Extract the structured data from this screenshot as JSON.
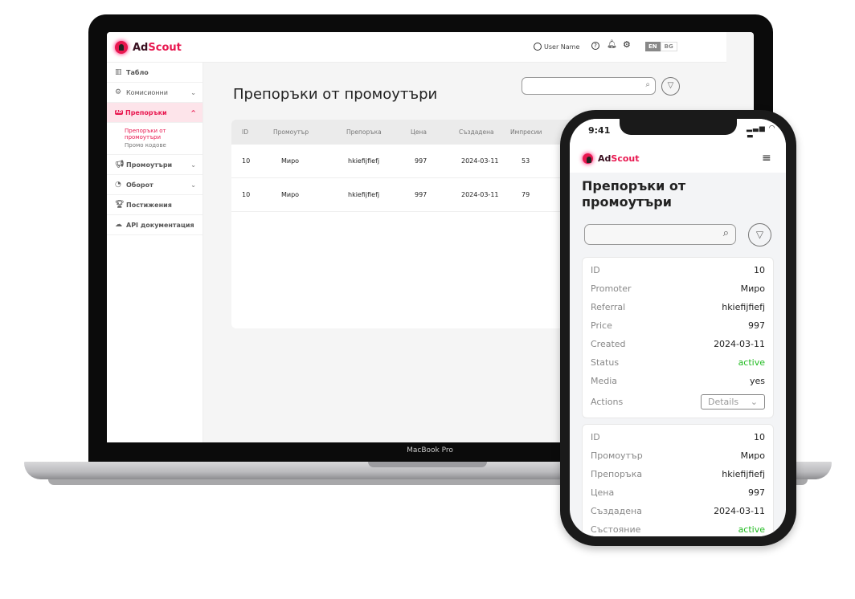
{
  "laptop": {
    "device_label": "MacBook Pro",
    "brand": {
      "ad": "Ad",
      "scout": "Scout"
    },
    "header": {
      "user": "User Name",
      "icons": [
        "user-icon",
        "help-icon",
        "bell-icon",
        "gear-icon"
      ],
      "lang": [
        "EN",
        "BG"
      ],
      "lang_active": "EN"
    },
    "sidebar": {
      "items": [
        {
          "label": "Табло",
          "icon": "dashboard-icon"
        },
        {
          "label": "Комисионни",
          "icon": "gear-icon",
          "chevron": "down"
        },
        {
          "label": "Препоръки",
          "icon": "ad-icon",
          "chevron": "up",
          "active": true
        },
        {
          "label": "Промоутъри",
          "icon": "megaphone-icon",
          "chevron": "down"
        },
        {
          "label": "Оборот",
          "icon": "chart-icon",
          "chevron": "down"
        },
        {
          "label": "Постижения",
          "icon": "trophy-icon"
        },
        {
          "label": "API документация",
          "icon": "cloud-icon"
        }
      ],
      "subitems": [
        {
          "label": "Препоръки от промоутъри",
          "active": true
        },
        {
          "label": "Промо кодове"
        }
      ]
    },
    "main": {
      "title": "Препоръки от промоутъри",
      "search_placeholder": "",
      "table": {
        "columns": [
          "ID",
          "Промоутър",
          "Препоръка",
          "Цена",
          "Създадена",
          "Импресии"
        ],
        "rows": [
          [
            "10",
            "Миро",
            "hkiefijfiefj",
            "997",
            "2024-03-11",
            "53"
          ],
          [
            "10",
            "Миро",
            "hkiefijfiefj",
            "997",
            "2024-03-11",
            "79"
          ]
        ]
      }
    }
  },
  "phone": {
    "time": "9:41",
    "title": "Препоръки от промоутъри",
    "search_placeholder": "",
    "cards": [
      {
        "rows": [
          [
            "ID",
            "10"
          ],
          [
            "Promoter",
            "Миро"
          ],
          [
            "Referral",
            "hkiefijfiefj"
          ],
          [
            "Price",
            "997"
          ],
          [
            "Created",
            "2024-03-11"
          ],
          [
            "Status",
            "active"
          ],
          [
            "Media",
            "yes"
          ]
        ],
        "actions_label": "Actions",
        "actions_value": "Details"
      },
      {
        "rows": [
          [
            "ID",
            "10"
          ],
          [
            "Промоутър",
            "Миро"
          ],
          [
            "Препоръка",
            "hkiefijfiefj"
          ],
          [
            "Цена",
            "997"
          ],
          [
            "Създадена",
            "2024-03-11"
          ],
          [
            "Състояние",
            "active"
          ]
        ]
      }
    ]
  },
  "colors": {
    "brand": "#e8174f",
    "active_status": "#22bb22"
  }
}
